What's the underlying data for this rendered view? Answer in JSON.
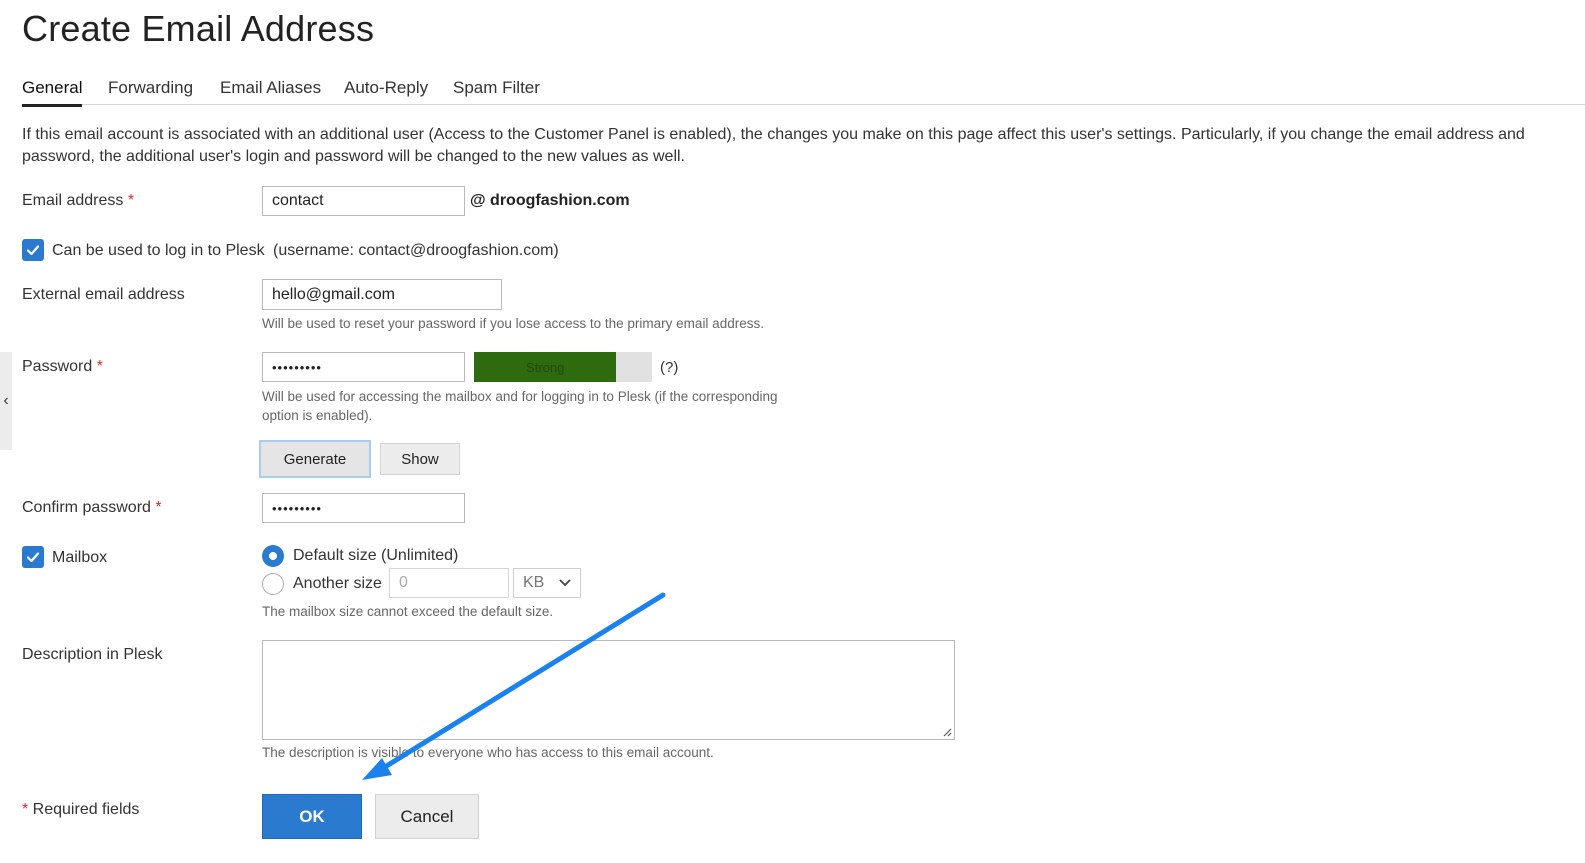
{
  "page": {
    "title": "Create Email Address"
  },
  "tabs": [
    "General",
    "Forwarding",
    "Email Aliases",
    "Auto-Reply",
    "Spam Filter"
  ],
  "intro": "If this email account is associated with an additional user (Access to the Customer Panel is enabled), the changes you make on this page affect this user's settings. Particularly, if you change the email address and password, the additional user's login and password will be changed to the new values as well.",
  "email": {
    "label": "Email address",
    "required_mark": "*",
    "value": "contact",
    "domain": "@ droogfashion.com"
  },
  "login": {
    "label": "Can be used to log in to Plesk",
    "username_note": "(username: contact@droogfashion.com)",
    "checked": true
  },
  "external": {
    "label": "External email address",
    "value": "hello@gmail.com",
    "hint": "Will be used to reset your password if you lose access to the primary email address."
  },
  "password": {
    "label": "Password",
    "required_mark": "*",
    "value": "•••••••••",
    "strength": "Strong",
    "strength_fraction": 0.8,
    "strength_color": "#2e6b0f",
    "help": "(?)",
    "hint": "Will be used for accessing the mailbox and for logging in to Plesk (if the corresponding option is enabled).",
    "generate_label": "Generate",
    "show_label": "Show"
  },
  "confirm": {
    "label": "Confirm password",
    "required_mark": "*",
    "value": "•••••••••"
  },
  "mailbox": {
    "label": "Mailbox",
    "checked": true,
    "default_label": "Default size (Unlimited)",
    "another_label": "Another size",
    "size_placeholder": "0",
    "unit": "KB",
    "hint": "The mailbox size cannot exceed the default size."
  },
  "description": {
    "label": "Description in Plesk",
    "value": "",
    "hint": "The description is visible to everyone who has access to this email account."
  },
  "footer": {
    "required_note": "* Required fields",
    "ok_label": "OK",
    "cancel_label": "Cancel"
  },
  "colors": {
    "accent": "#2a7bd0",
    "arrow": "#1a82f0"
  }
}
